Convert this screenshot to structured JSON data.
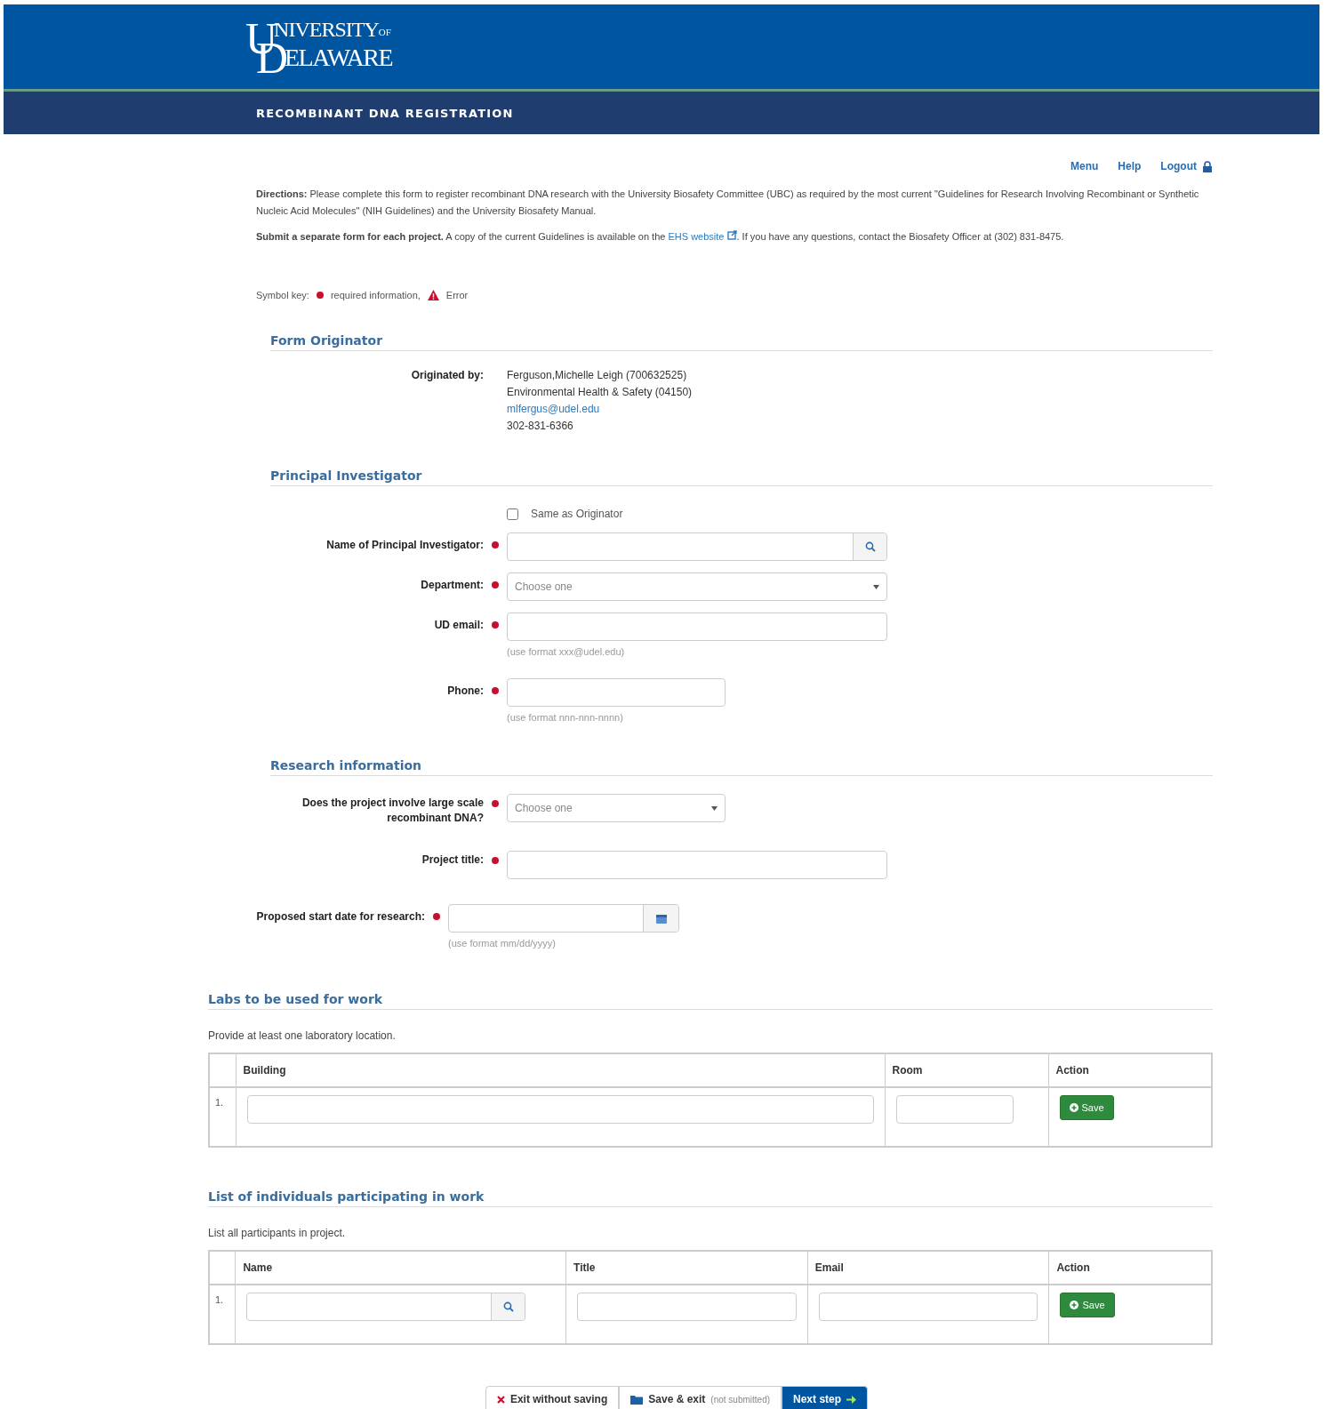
{
  "header": {
    "logo": {
      "big_top": "U",
      "small_top": "NIVERSITY",
      "of": "OF",
      "big_bottom": "D",
      "small_bottom": "ELAWARE"
    },
    "title": "RECOMBINANT DNA REGISTRATION"
  },
  "nav": [
    {
      "label": "Menu",
      "kind": "link"
    },
    {
      "label": "Help",
      "kind": "link"
    },
    {
      "label": "Logout",
      "kind": "logout"
    }
  ],
  "directions": {
    "lead": "Directions:",
    "text": "Please complete this form to register recombinant DNA research with the University Biosafety Committee (UBC) as required by the most current \"Guidelines for Research Involving Recombinant or Synthetic Nucleic Acid Molecules\" (NIH Guidelines) and the University Biosafety Manual."
  },
  "submit_note": {
    "lead": "Submit a separate form for each project.",
    "before_link": "A copy of the current Guidelines is available on the",
    "link": "EHS website",
    "after_link": ". If you have any questions, contact the Biosafety Officer at (302) 831-8475."
  },
  "symbol_key": {
    "label": "Symbol key:",
    "required": "required information,",
    "error": "Error"
  },
  "form_originator": {
    "heading": "Form Originator",
    "label": "Originated by:",
    "lines": [
      {
        "text": "Ferguson,Michelle Leigh (700632525)",
        "kind": "text"
      },
      {
        "text": "Environmental Health & Safety (04150)",
        "kind": "text"
      },
      {
        "text": "mlfergus@udel.edu",
        "kind": "email"
      },
      {
        "text": "302-831-6366",
        "kind": "text"
      }
    ]
  },
  "principal_investigator": {
    "heading": "Principal Investigator",
    "same_as_originator": {
      "label": "Same as Originator",
      "checked": false
    },
    "fields": [
      {
        "label": "Name of Principal Investigator:",
        "kind": "search",
        "required": true
      },
      {
        "label": "Department:",
        "kind": "select",
        "placeholder": "Choose one",
        "required": true
      },
      {
        "label": "UD email:",
        "kind": "text",
        "required": true,
        "hint": "(use format xxx@udel.edu)"
      },
      {
        "label": "Phone:",
        "kind": "shorttext",
        "required": true,
        "hint": "(use format nnn-nnn-nnnn)"
      }
    ]
  },
  "research_information": {
    "heading": "Research information",
    "fields": [
      {
        "label": "Does the project involve large scale recombinant DNA?",
        "kind": "shortselect",
        "placeholder": "Choose one",
        "required": true
      },
      {
        "label": "Project title:",
        "kind": "text",
        "required": true
      }
    ],
    "start_date": {
      "label": "Proposed start date for research:",
      "required": true,
      "hint": "(use format mm/dd/yyyy)"
    }
  },
  "labs": {
    "heading": "Labs to be used for work",
    "instruction": "Provide at least one laboratory location.",
    "columns": [
      {
        "label": "Building",
        "kind": "text"
      },
      {
        "label": "Room",
        "kind": "short"
      },
      {
        "label": "Action",
        "kind": "action"
      }
    ],
    "rows": [
      {
        "number": "1.",
        "action": "Save"
      }
    ]
  },
  "participants": {
    "heading": "List of individuals participating in work",
    "instruction": "List all participants in project.",
    "columns": [
      {
        "label": "Name",
        "kind": "search"
      },
      {
        "label": "Title",
        "kind": "text"
      },
      {
        "label": "Email",
        "kind": "text"
      },
      {
        "label": "Action",
        "kind": "action"
      }
    ],
    "rows": [
      {
        "number": "1.",
        "action": "Save"
      }
    ]
  },
  "footer_buttons": [
    {
      "label": "Exit without saving",
      "kind": "exit"
    },
    {
      "label": "Save & exit",
      "note": "(not submitted)",
      "kind": "save"
    },
    {
      "label": "Next step",
      "kind": "next"
    }
  ]
}
